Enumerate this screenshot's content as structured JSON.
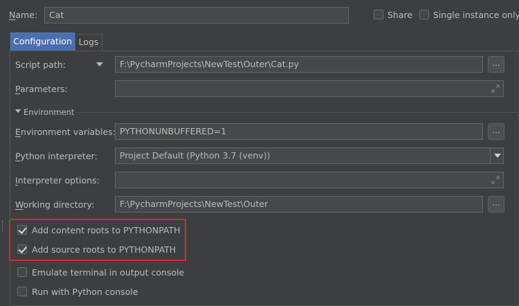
{
  "name": {
    "label": "Name:",
    "value": "Cat"
  },
  "share": {
    "label": "Share",
    "checked": false
  },
  "single_instance": {
    "label": "Single instance only",
    "checked": false
  },
  "tabs": [
    {
      "label": "Configuration",
      "active": true
    },
    {
      "label": "Logs",
      "active": false
    }
  ],
  "script_path": {
    "label": "Script path:",
    "value": "F:\\PycharmProjects\\NewTest\\Outer\\Cat.py",
    "browse": "..."
  },
  "parameters": {
    "label": "Parameters:",
    "value": ""
  },
  "environment": {
    "label": "Environment"
  },
  "env_vars": {
    "label": "Environment variables:",
    "value": "PYTHONUNBUFFERED=1",
    "browse": "..."
  },
  "interpreter": {
    "label": "Python interpreter:",
    "value": "Project Default (Python 3.7 (venv))"
  },
  "interpreter_options": {
    "label": "Interpreter options:",
    "value": ""
  },
  "working_dir": {
    "label": "Working directory:",
    "value": "F:\\PycharmProjects\\NewTest\\Outer",
    "browse": "..."
  },
  "checkboxes": [
    {
      "label": "Add content roots to PYTHONPATH",
      "checked": true
    },
    {
      "label": "Add source roots to PYTHONPATH",
      "checked": true
    },
    {
      "label": "Emulate terminal in output console",
      "checked": false
    },
    {
      "label": "Run with Python console",
      "checked": false
    }
  ],
  "colors": {
    "background": "#3c3f41",
    "field_bg": "#45494a",
    "tab_active": "#4b6eaf",
    "highlight_box": "#e0261f"
  }
}
